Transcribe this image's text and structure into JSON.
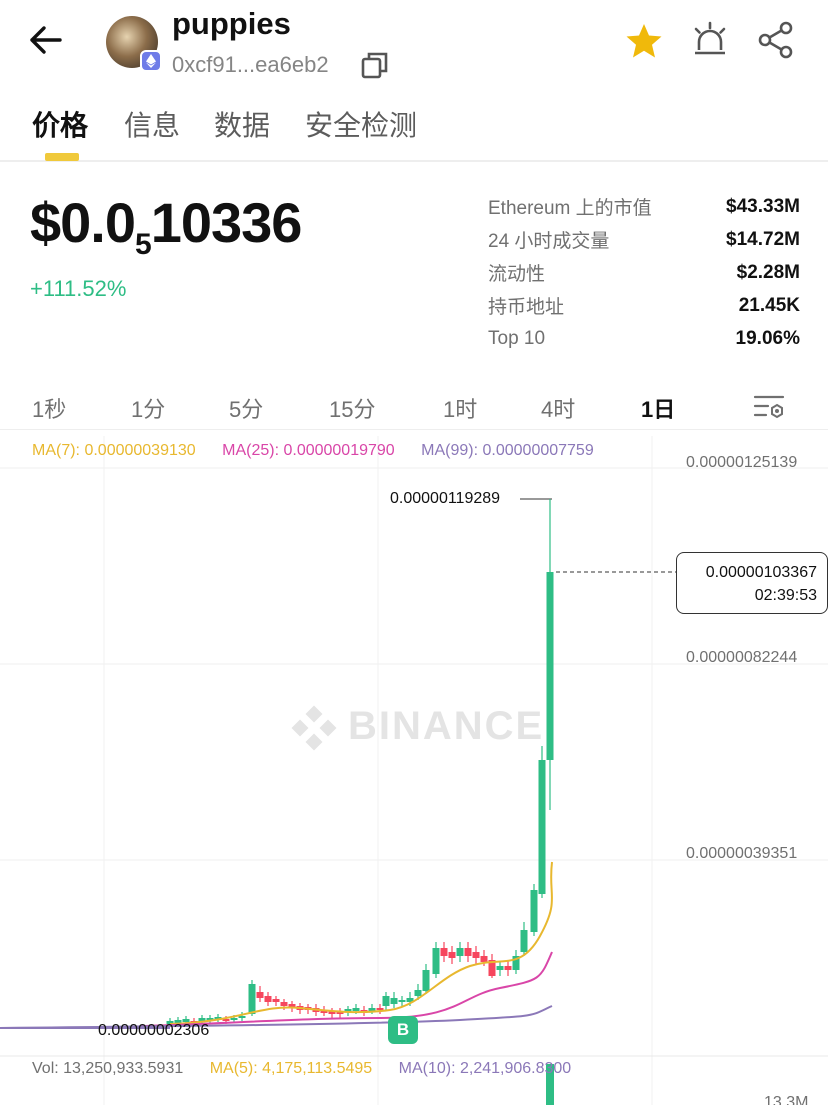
{
  "header": {
    "token_name": "puppies",
    "token_address": "0xcf91...ea6eb2"
  },
  "tabs": [
    {
      "label": "价格",
      "active": true
    },
    {
      "label": "信息",
      "active": false
    },
    {
      "label": "数据",
      "active": false
    },
    {
      "label": "安全检测",
      "active": false
    }
  ],
  "price": {
    "prefix": "$0.0",
    "zeros_subscript": "5",
    "digits": "10336",
    "change": "+111.52%"
  },
  "stats": [
    {
      "label": "Ethereum 上的市值",
      "value": "$43.33M"
    },
    {
      "label": "24 小时成交量",
      "value": "$14.72M"
    },
    {
      "label": "流动性",
      "value": "$2.28M"
    },
    {
      "label": "持币地址",
      "value": "21.45K"
    },
    {
      "label": "Top 10",
      "value": "19.06%"
    }
  ],
  "intervals": [
    {
      "label": "1秒",
      "active": false
    },
    {
      "label": "1分",
      "active": false
    },
    {
      "label": "5分",
      "active": false
    },
    {
      "label": "15分",
      "active": false
    },
    {
      "label": "1时",
      "active": false
    },
    {
      "label": "4时",
      "active": false
    },
    {
      "label": "1日",
      "active": true
    }
  ],
  "chart": {
    "ma": {
      "ma7": "MA(7): 0.00000039130",
      "ma25": "MA(25): 0.00000019790",
      "ma99": "MA(99): 0.00000007759"
    },
    "y_axis": [
      "0.00000125139",
      "0.00000082244",
      "0.00000039351"
    ],
    "current_price": "0.00000103367",
    "current_time": "02:39:53",
    "high_label": "0.00000119289",
    "low_label": "0.00000002306",
    "watermark": "BINANCE",
    "marker": "B",
    "volume": {
      "vol": "Vol: 13,250,933.5931",
      "ma5": "MA(5): 4,175,113.5495",
      "ma10": "MA(10): 2,241,906.8300",
      "axis_max": "13.3M"
    },
    "colors": {
      "up": "#2ebd85",
      "down": "#f6465d",
      "ma7": "#e8b82f",
      "ma25": "#d946a8",
      "ma99": "#8b78b8"
    }
  }
}
